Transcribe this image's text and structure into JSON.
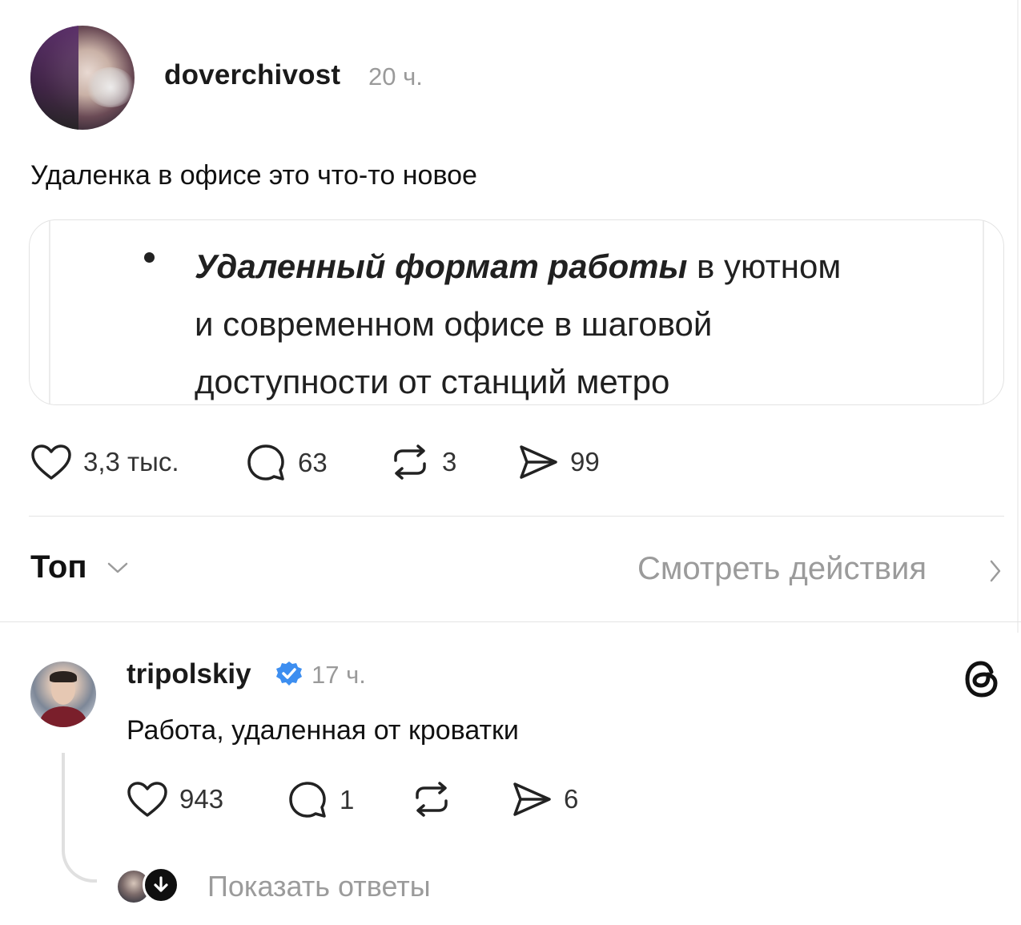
{
  "post": {
    "username": "doverchivost",
    "time": "20 ч.",
    "text": "Удаленка в офисе это что-то новое",
    "image": {
      "bold_text": "Удаленный формат работы",
      "line1_rest": " в уютном",
      "line2": "и современном офисе в шаговой",
      "line3": "доступности от станций метро"
    },
    "actions": {
      "likes": "3,3 тыс.",
      "comments": "63",
      "reposts": "3",
      "shares": "99"
    }
  },
  "sort": {
    "label": "Топ",
    "view_activity": "Смотреть действия"
  },
  "reply": {
    "username": "tripolskiy",
    "time": "17 ч.",
    "text": "Работа, удаленная от кроватки",
    "actions": {
      "likes": "943",
      "comments": "1",
      "reposts": "",
      "shares": "6"
    },
    "show_replies": "Показать ответы"
  },
  "colors": {
    "text": "#111111",
    "muted": "#9b9b9b",
    "divider": "#e4e4e4",
    "verified": "#3d8ef0"
  },
  "icons": [
    "heart-icon",
    "comment-icon",
    "repost-icon",
    "share-icon",
    "verified-icon",
    "threads-icon",
    "chevron-down-icon",
    "chevron-right-icon",
    "arrow-down-icon"
  ]
}
